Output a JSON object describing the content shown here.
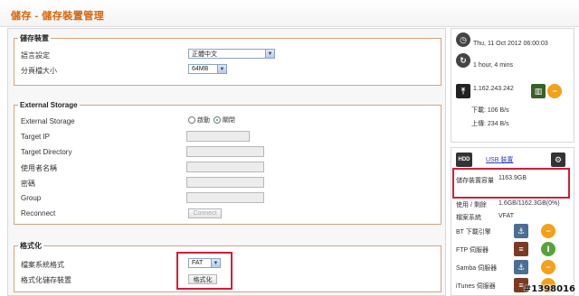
{
  "page": {
    "title": "儲存 - 儲存裝置管理"
  },
  "storage_device": {
    "legend": "儲存裝置",
    "language_label": "語言設定",
    "language_value": "正體中文",
    "page_size_label": "分頁檔大小",
    "page_size_value": "64MB"
  },
  "external_storage": {
    "legend": "External Storage",
    "toggle_label": "External Storage",
    "option_on": "啟動",
    "option_off": "關閉",
    "selected": "關閉",
    "target_ip_label": "Target IP",
    "target_dir_label": "Target Directory",
    "username_label": "使用者名稱",
    "password_label": "密碼",
    "group_label": "Group",
    "reconnect_label": "Reconnect",
    "connect_button": "Connect"
  },
  "format": {
    "legend": "格式化",
    "fs_label": "檔案系統格式",
    "fs_value": "FAT",
    "format_label": "格式化儲存裝置",
    "format_button": "格式化"
  },
  "status": {
    "datetime": "Thu, 11 Oct 2012 06:00:03",
    "uptime": "1 hour, 4 mins",
    "ip": "1.162.243.242",
    "download": "下載: 106 B/s",
    "upload": "上傳: 234 B/s"
  },
  "usb": {
    "icon_label": "HDD",
    "title": "USB 裝置",
    "capacity_label": "儲存裝置容量",
    "capacity_value": "1163.9GB",
    "used_label": "使用 / 剩餘",
    "used_value": "1.6GB/1162.3GB(0%)",
    "fs_label": "檔案系統",
    "fs_value": "VFAT",
    "services": [
      {
        "name": "BT 下載引擎"
      },
      {
        "name": "FTP 伺服器"
      },
      {
        "name": "Samba 伺服器"
      },
      {
        "name": "iTunes 伺服器"
      }
    ]
  },
  "watermark": "#1398016",
  "colors": {
    "title": "#d9640a",
    "highlight": "#d41c3a",
    "fieldset_border": "#d4a380"
  }
}
